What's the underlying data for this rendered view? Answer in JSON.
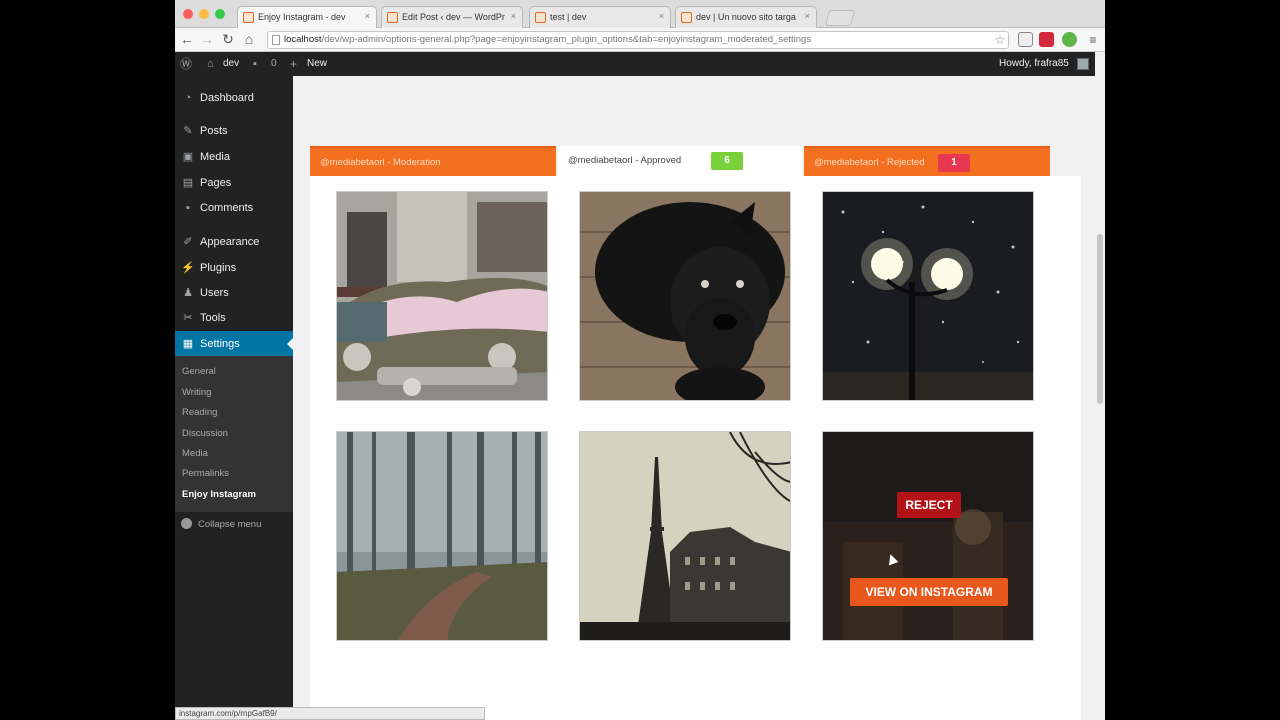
{
  "browser": {
    "tabs": [
      {
        "label": "Enjoy Instagram - dev"
      },
      {
        "label": "Edit Post ‹ dev — WordPr"
      },
      {
        "label": "test | dev"
      },
      {
        "label": "dev | Un nuovo sito targa"
      }
    ],
    "url_host": "localhost",
    "url_path": "/dev/wp-admin/options-general.php?page=enjoyinstagram_plugin_options&tab=enjoyinstagram_moderated_settings",
    "status_url": "instagram.com/p/rnpGafB9/"
  },
  "adminbar": {
    "site_name": "dev",
    "comments_count": "0",
    "new_label": "New",
    "howdy": "Howdy, frafra85"
  },
  "sidebar": {
    "items": [
      {
        "label": "Dashboard",
        "icon": "dashboard-icon"
      },
      {
        "label": "Posts",
        "icon": "pin-icon"
      },
      {
        "label": "Media",
        "icon": "media-icon"
      },
      {
        "label": "Pages",
        "icon": "pages-icon"
      },
      {
        "label": "Comments",
        "icon": "comment-icon"
      },
      {
        "label": "Appearance",
        "icon": "brush-icon"
      },
      {
        "label": "Plugins",
        "icon": "plugin-icon"
      },
      {
        "label": "Users",
        "icon": "users-icon"
      },
      {
        "label": "Tools",
        "icon": "wrench-icon"
      },
      {
        "label": "Settings",
        "icon": "settings-icon"
      }
    ],
    "submenu": [
      "General",
      "Writing",
      "Reading",
      "Discussion",
      "Media",
      "Permalinks",
      "Enjoy Instagram"
    ],
    "collapse_label": "Collapse menu"
  },
  "moderation": {
    "tabs": [
      {
        "label": "@mediabetaorl - Moderation"
      },
      {
        "label": "@mediabetaorl - Approved",
        "count": "6",
        "badge_color": "#7ad03a"
      },
      {
        "label": "@mediabetaorl - Rejected",
        "count": "1",
        "badge_color": "#e8384f"
      }
    ],
    "photos": [
      {
        "subject": "old car in snow"
      },
      {
        "subject": "black puppy"
      },
      {
        "subject": "street lamps in snow at night"
      },
      {
        "subject": "foggy forest path"
      },
      {
        "subject": "Eiffel tower and buildings"
      },
      {
        "subject": "dark night scene"
      }
    ],
    "reject_label": "REJECT",
    "view_label": "VIEW ON INSTAGRAM"
  }
}
